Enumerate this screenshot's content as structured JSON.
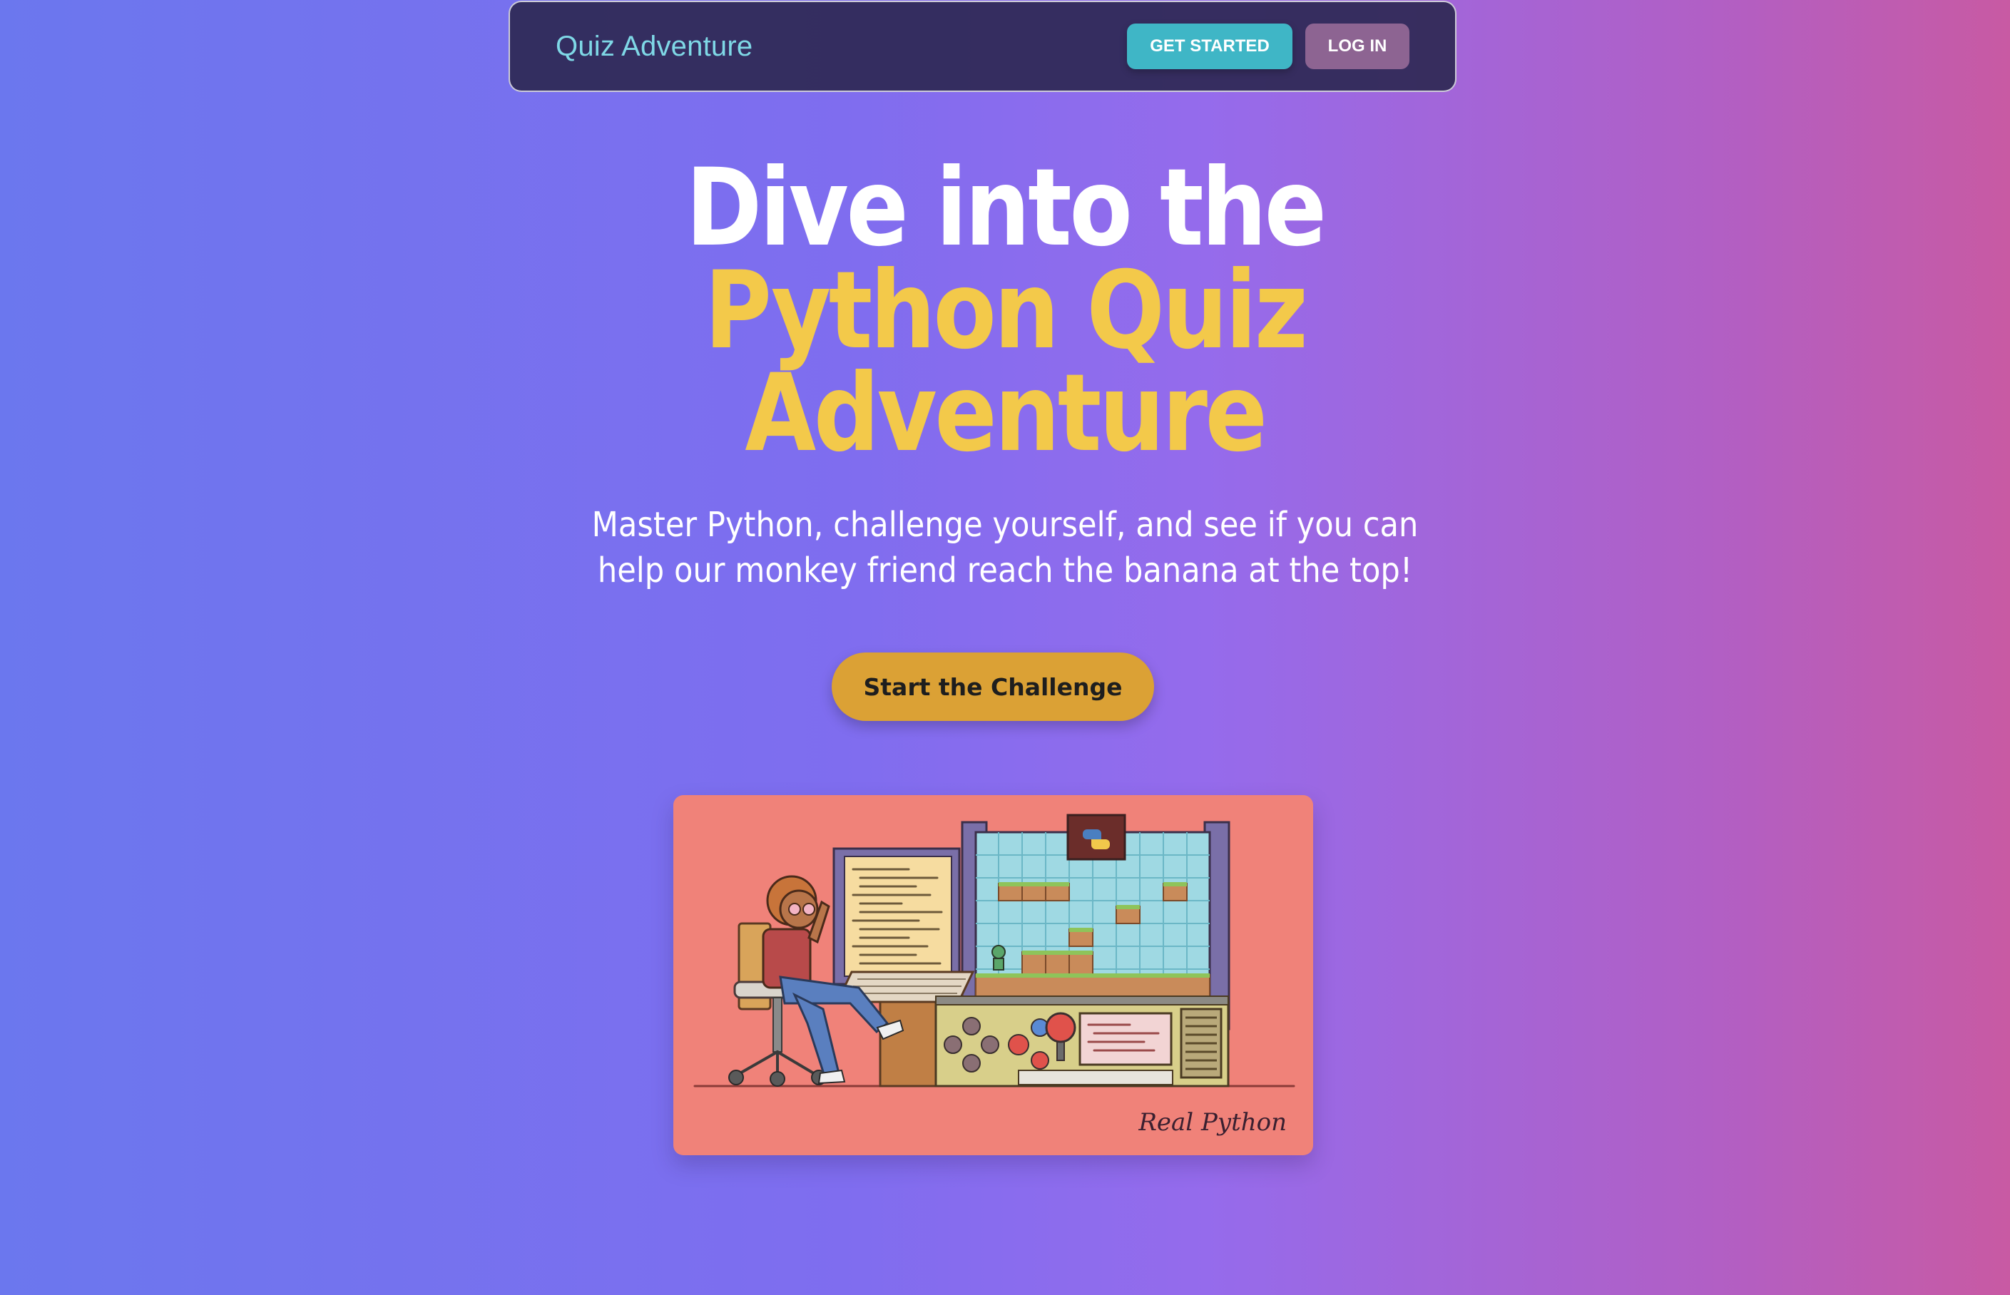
{
  "navbar": {
    "brand": "Quiz Adventure",
    "get_started_label": "GET STARTED",
    "login_label": "LOG IN"
  },
  "hero": {
    "headline_line1": "Dive into the",
    "headline_line2": "Python Quiz",
    "headline_line3": "Adventure",
    "subtitle": "Master Python, challenge yourself, and see if you can help our monkey friend reach the banana at the top!",
    "cta_label": "Start the Challenge"
  },
  "illustration": {
    "watermark": "Real Python"
  },
  "colors": {
    "accent_yellow": "#f3c94a",
    "brand_teal": "#7fd8e6",
    "primary_button": "#3fb6c6",
    "secondary_button": "#8d6492",
    "cta": "#dba135",
    "card": "#f08279"
  }
}
